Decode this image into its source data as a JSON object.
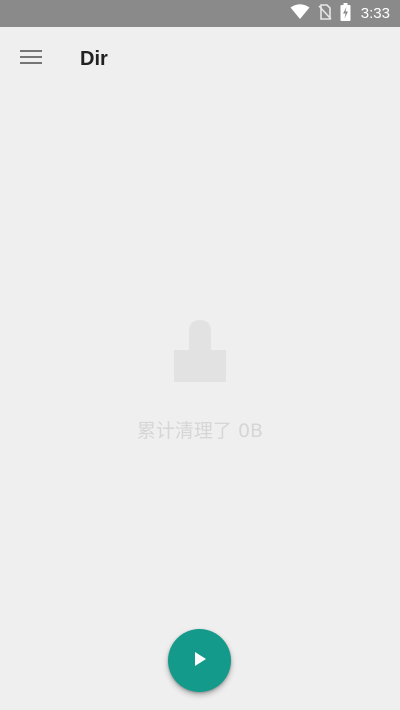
{
  "status_bar": {
    "time": "3:33",
    "icons": [
      "wifi-icon",
      "no-sim-icon",
      "battery-charging-icon"
    ]
  },
  "app_bar": {
    "menu_icon": "menu-icon",
    "title": "Dir"
  },
  "empty_state": {
    "icon": "broom-icon",
    "message": "累计清理了 0B"
  },
  "fab": {
    "icon": "play-icon"
  },
  "colors": {
    "status_bar": "#8a8a8a",
    "background": "#efefef",
    "accent": "#149a8a",
    "muted_text": "#d6d6d6"
  }
}
